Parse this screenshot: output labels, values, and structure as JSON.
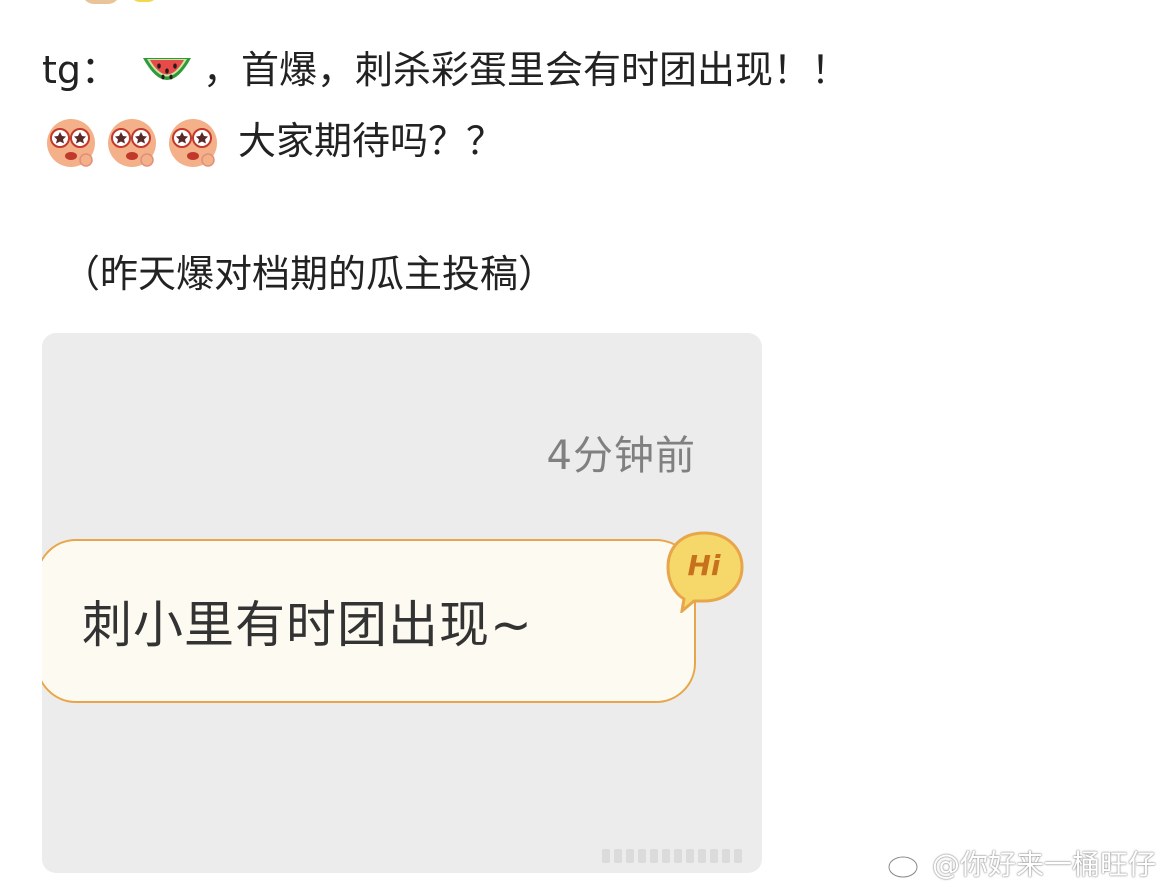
{
  "post": {
    "line1_prefix": "tg：",
    "line1_text": "，首爆，刺杀彩蛋里会有时团出现！！",
    "line2_text": "大家期待吗？？",
    "line3_text": "（昨天爆对档期的瓜主投稿）",
    "emojis": [
      "watermelon-emoji",
      "starry-eyed-emoji",
      "starry-eyed-emoji",
      "starry-eyed-emoji"
    ]
  },
  "screenshot": {
    "timestamp": "4分钟前",
    "bubble_text": "刺小里有时团出现~",
    "badge_text": "Hi",
    "bubble_border_color": "#e8a64a",
    "badge_color": "#c7711d"
  },
  "watermark": {
    "text": "@你好来一桶旺仔",
    "icon": "weibo-icon"
  },
  "colors": {
    "text": "#222222",
    "card_bg": "#ececec",
    "timestamp": "#808080"
  }
}
